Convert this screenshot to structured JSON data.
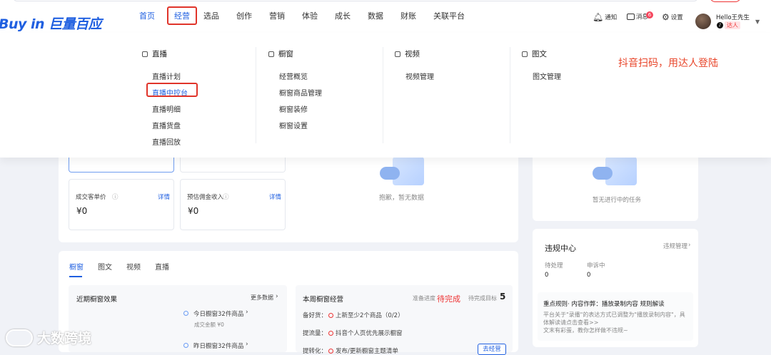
{
  "brand": {
    "logo": "Buy in 巨量百应"
  },
  "nav": {
    "items": [
      "首页",
      "经营",
      "选品",
      "创作",
      "营销",
      "体验",
      "成长",
      "数据",
      "财账",
      "关联平台"
    ]
  },
  "header": {
    "notify": "通知",
    "message": "消息",
    "message_count": "6",
    "settings": "设置",
    "user": "Hello王先生",
    "tag": "达人"
  },
  "menu": {
    "live": {
      "title": "直播",
      "items": [
        "直播计划",
        "直播中控台",
        "直播明细",
        "直播货盘",
        "直播回放"
      ]
    },
    "window": {
      "title": "橱窗",
      "items": [
        "经营概览",
        "橱窗商品管理",
        "橱窗装修",
        "橱窗设置"
      ]
    },
    "video": {
      "title": "视频",
      "items": [
        "视频管理"
      ]
    },
    "graphic": {
      "title": "图文",
      "items": [
        "图文管理"
      ]
    }
  },
  "annotation": "抖音扫码，用达人登陆",
  "stats": {
    "customer_price": "成交客单价",
    "estimated_income": "预估佣金收入",
    "detail": "详情",
    "value": "¥0"
  },
  "empty": {
    "no_data": "抱歉，暂无数据",
    "no_task": "暂无进行中的任务"
  },
  "violation": {
    "title": "违规中心",
    "manage": "违规管理",
    "pending": "待处理",
    "pending_val": "0",
    "appeal": "申诉中",
    "appeal_val": "0",
    "rule_title": "重点规则· 内容作弊：播放录制内容 规则解读",
    "rule_desc1": "平台关于\"录播\"的表达方式已调整为\"播放录制内容\"，具体解读请点击查看>>",
    "rule_desc2": "文末有彩蛋，教你怎样做不违规~"
  },
  "tabs": [
    "橱窗",
    "图文",
    "视频",
    "直播"
  ],
  "recent": {
    "title": "近期橱窗效果",
    "more": "更多数据",
    "today": "今日橱窗32件商品",
    "today_sub": "成交金额 ¥0",
    "yesterday": "昨日橱窗32件商品"
  },
  "weekly": {
    "title": "本周橱窗经营",
    "progress_label": "准备进度",
    "progress": "待完成",
    "target_label": "待完成目标",
    "target": "5",
    "rows": [
      {
        "label": "备好货：",
        "text": "上新至少2个商品（0/2）"
      },
      {
        "label": "提流量：",
        "text": "抖音个人页优先展示橱窗"
      },
      {
        "label": "提转化：",
        "text": "发布/更新橱窗主题清单"
      }
    ],
    "button": "去经营"
  },
  "watermark": "大数跨境"
}
